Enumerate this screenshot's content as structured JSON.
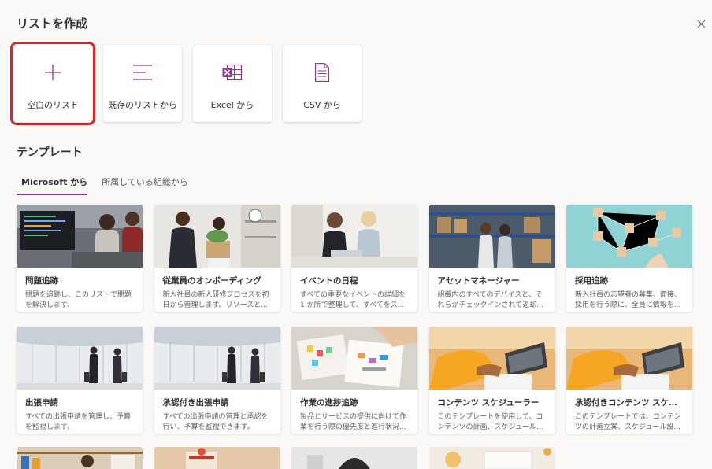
{
  "dialog": {
    "title": "リストを作成",
    "close_label": "閉じる"
  },
  "create_options": [
    {
      "label": "空白のリスト",
      "icon": "plus-icon",
      "selected": true
    },
    {
      "label": "既存のリストから",
      "icon": "list-lines-icon"
    },
    {
      "label": "Excel から",
      "icon": "excel-icon"
    },
    {
      "label": "CSV から",
      "icon": "csv-file-icon"
    }
  ],
  "templates_section": {
    "title": "テンプレート"
  },
  "tabs": [
    {
      "label": "Microsoft から",
      "active": true
    },
    {
      "label": "所属している組織から",
      "active": false
    }
  ],
  "templates": [
    {
      "title": "問題追跡",
      "desc": "問題を追跡し、このリストで問題を解決します。"
    },
    {
      "title": "従業員のオンボーディング",
      "desc": "新入社員の新人研修プロセスを初日から管理します。リソースと..."
    },
    {
      "title": "イベントの日程",
      "desc": "すべての重要なイベントの詳細を 1 か所で整理して、すべてをス..."
    },
    {
      "title": "アセットマネージャー",
      "desc": "組織内のすべてのデバイスと、それらがチェックインされて返却..."
    },
    {
      "title": "採用追跡",
      "desc": "新入社員の志望者の募集、面接、採用を行う際に、全員に情報を..."
    },
    {
      "title": "出張申請",
      "desc": "すべての出張申請を管理し、予算を監視します。"
    },
    {
      "title": "承認付き出張申請",
      "desc": "すべての出張申請の管理と承認を行い、予算を監視できます。"
    },
    {
      "title": "作業の進捗追跡",
      "desc": "製品とサービスの提供に向けて作業を行う際の優先度と進行状況..."
    },
    {
      "title": "コンテンツ スケジューラー",
      "desc": "このテンプレートを使用して、コンテンツの計画、スケジュール..."
    },
    {
      "title": "承認付きコンテンツ スケジ...",
      "desc": "このテンプレートでは、コンテンツの計画立案、スケジュール設..."
    }
  ],
  "colors": {
    "accent": "#8a3b8f",
    "highlight_border": "#d8282f",
    "excel_icon": "#8a3b8f"
  }
}
